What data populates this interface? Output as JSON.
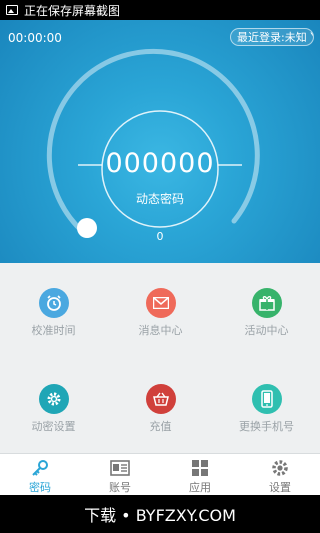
{
  "statusbar": {
    "text": "正在保存屏幕截图"
  },
  "hero": {
    "timer": "00:00:00",
    "login_text": "最近登录:未知",
    "code": "000000",
    "code_label": "动态密码",
    "progress_value": "0"
  },
  "grid": {
    "items": [
      {
        "label": "校准时间",
        "icon": "alarm-clock-icon",
        "color": "#4aa8e0"
      },
      {
        "label": "消息中心",
        "icon": "mail-icon",
        "color": "#ef6a5a"
      },
      {
        "label": "活动中心",
        "icon": "gift-icon",
        "color": "#37b36b"
      },
      {
        "label": "动密设置",
        "icon": "gear-icon",
        "color": "#1fa6b6"
      },
      {
        "label": "充值",
        "icon": "basket-icon",
        "color": "#d0403b"
      },
      {
        "label": "更换手机号",
        "icon": "phone-icon",
        "color": "#2fbfb0"
      }
    ]
  },
  "tabs": [
    {
      "label": "密码",
      "icon": "key-icon"
    },
    {
      "label": "账号",
      "icon": "id-card-icon"
    },
    {
      "label": "应用",
      "icon": "grid-icon"
    },
    {
      "label": "设置",
      "icon": "gear-icon"
    }
  ],
  "watermark": {
    "text": "下载 • BYFZXY.COM"
  }
}
